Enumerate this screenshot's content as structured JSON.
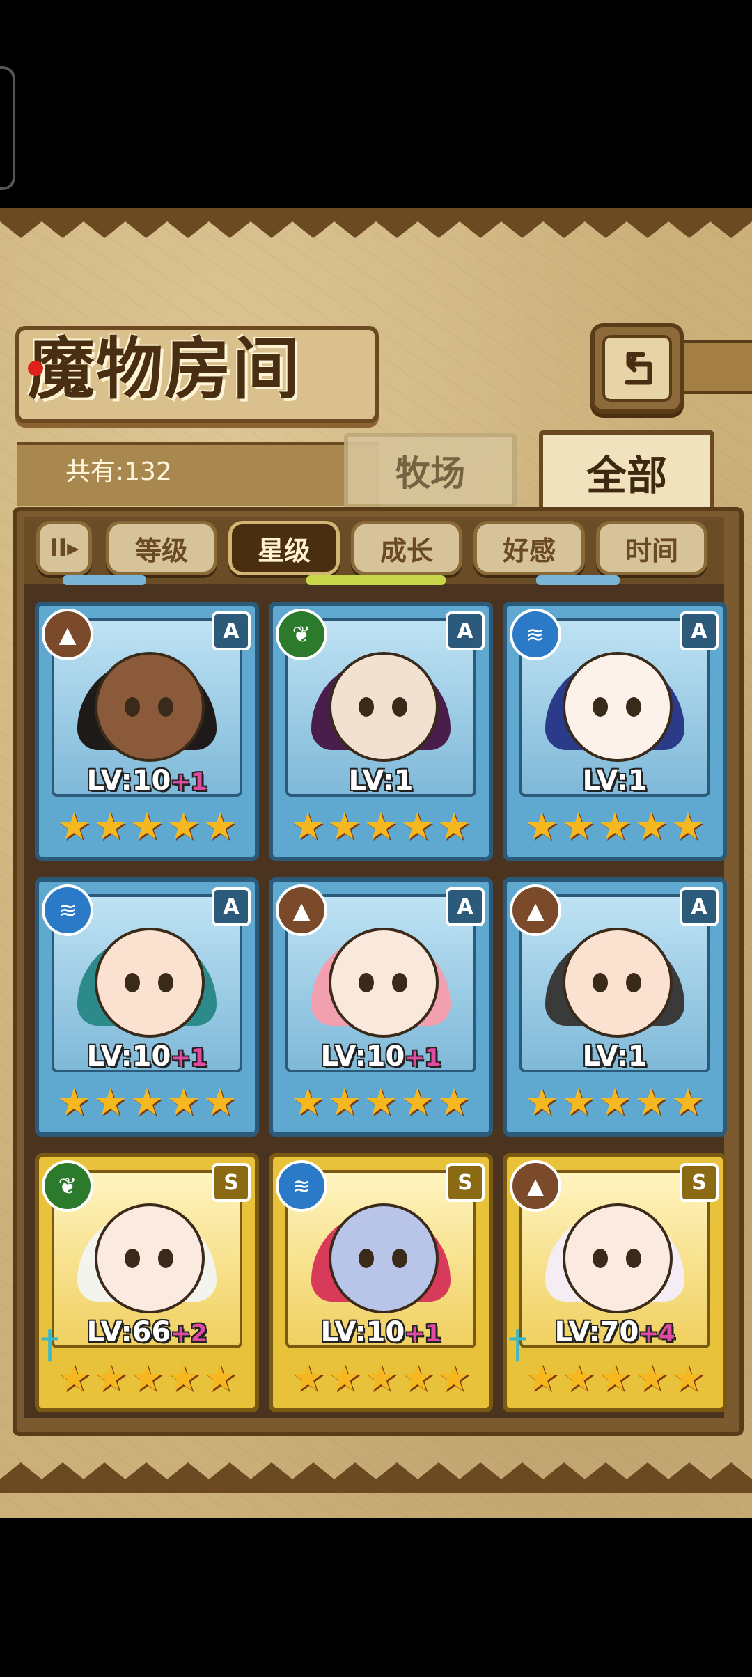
{
  "title": "魔物房间",
  "count_text": "共有:132",
  "tabs": {
    "ranch": "牧场",
    "all": "全部"
  },
  "filters": {
    "icon_label": "II▸",
    "items": [
      "等级",
      "星级",
      "成长",
      "好感",
      "时间"
    ],
    "selected": "星级"
  },
  "colors": {
    "rank_a_frame": "#5fa9d0",
    "rank_s_frame": "#e8c23a",
    "selected_filter": "#4a2e12"
  },
  "cards": [
    {
      "element": "earth",
      "element_icon": "mountain-icon",
      "rank": "A",
      "level": "LV:10",
      "plus": "+1",
      "stars": 5,
      "hair": "#1e1a1a",
      "skin": "#8a5a3a"
    },
    {
      "element": "leaf",
      "element_icon": "leaf-icon",
      "rank": "A",
      "level": "LV:1",
      "plus": "",
      "stars": 5,
      "hair": "#4a1e4a",
      "skin": "#f2e0d0"
    },
    {
      "element": "water",
      "element_icon": "water-icon",
      "rank": "A",
      "level": "LV:1",
      "plus": "",
      "stars": 5,
      "hair": "#2c3a8a",
      "skin": "#fdf2ea"
    },
    {
      "element": "water",
      "element_icon": "water-icon",
      "rank": "A",
      "level": "LV:10",
      "plus": "+1",
      "stars": 5,
      "hair": "#2c8a8a",
      "skin": "#fbe1cf"
    },
    {
      "element": "earth",
      "element_icon": "mountain-icon",
      "rank": "A",
      "level": "LV:10",
      "plus": "+1",
      "stars": 5,
      "hair": "#f2a0b0",
      "skin": "#fbe8dc"
    },
    {
      "element": "earth",
      "element_icon": "mountain-icon",
      "rank": "A",
      "level": "LV:1",
      "plus": "",
      "stars": 5,
      "hair": "#3a3a3a",
      "skin": "#fbe1cf"
    },
    {
      "element": "leaf",
      "element_icon": "leaf-icon",
      "rank": "S",
      "level": "LV:66",
      "plus": "+2",
      "stars": 5,
      "hair": "#f4f4ee",
      "skin": "#fbeadf"
    },
    {
      "element": "water",
      "element_icon": "water-icon",
      "rank": "S",
      "level": "LV:10",
      "plus": "+1",
      "stars": 5,
      "hair": "#d83a5a",
      "skin": "#b8c4e8"
    },
    {
      "element": "earth",
      "element_icon": "mountain-icon",
      "rank": "S",
      "level": "LV:70",
      "plus": "+4",
      "stars": 5,
      "hair": "#f4eef4",
      "skin": "#fbeadf"
    }
  ]
}
